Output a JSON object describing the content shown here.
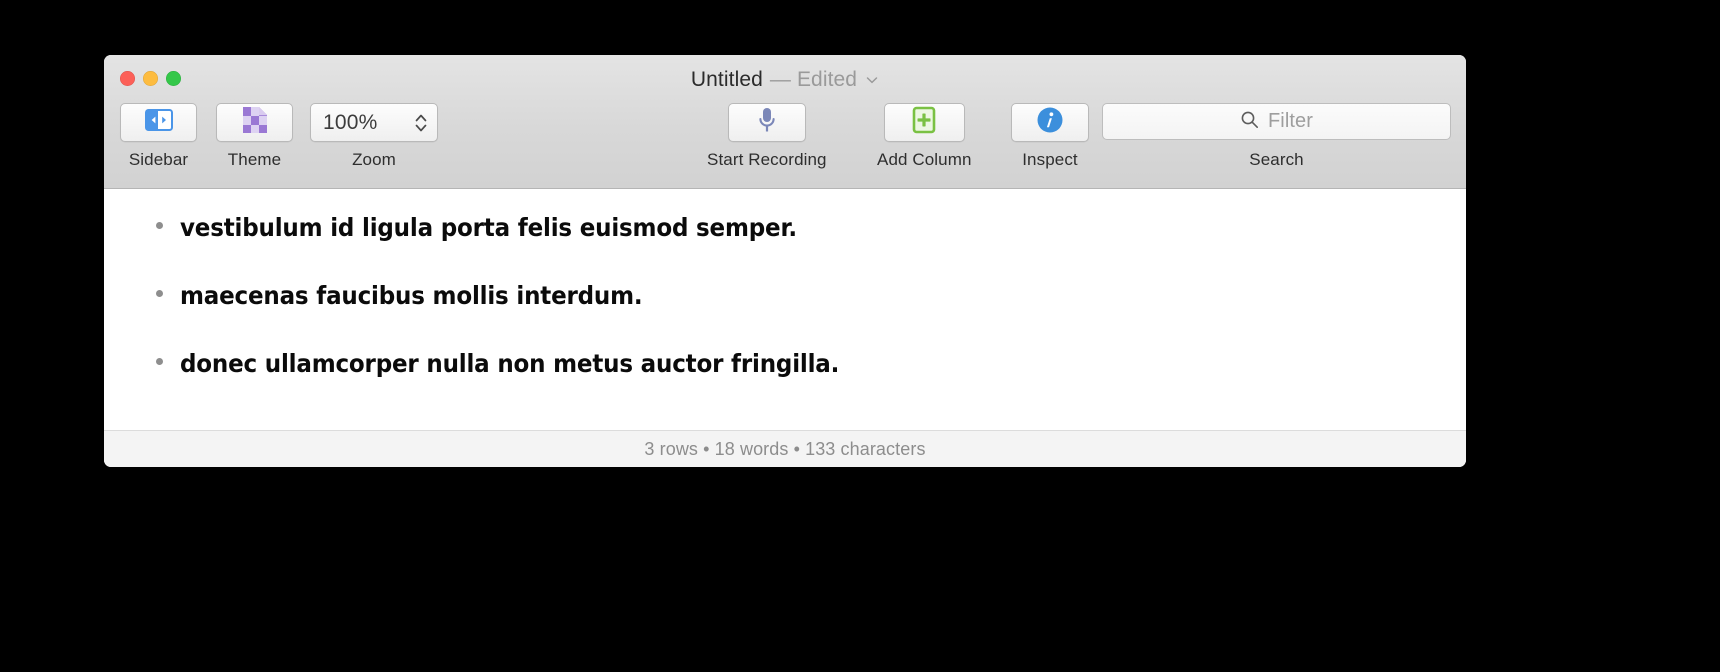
{
  "window": {
    "title": "Untitled",
    "edited_label": "— Edited",
    "title_menu_icon": "chevron-down-icon",
    "traffic_lights": [
      {
        "name": "close",
        "color": "#fc6058"
      },
      {
        "name": "minimize",
        "color": "#fdbc40"
      },
      {
        "name": "zoom",
        "color": "#34c749"
      }
    ]
  },
  "toolbar": {
    "sidebar": {
      "label": "Sidebar",
      "icon": "sidebar-icon",
      "accent": "#4a95e8"
    },
    "theme": {
      "label": "Theme",
      "icon": "theme-document-icon",
      "accent": "#9b7fd4"
    },
    "zoom": {
      "label": "Zoom",
      "value": "100%",
      "icon": "stepper-arrows-icon"
    },
    "record": {
      "label": "Start Recording",
      "icon": "microphone-icon",
      "accent": "#7b87b8"
    },
    "add_column": {
      "label": "Add Column",
      "icon": "add-column-icon",
      "accent": "#7ac143"
    },
    "inspect": {
      "label": "Inspect",
      "icon": "info-circle-icon",
      "accent": "#3c8fdc"
    },
    "search": {
      "label": "Search",
      "placeholder": "Filter",
      "value": "",
      "icon": "search-icon"
    }
  },
  "document": {
    "rows": [
      {
        "bullet": "•",
        "text": "vestibulum id ligula porta felis euismod semper."
      },
      {
        "bullet": "•",
        "text": "maecenas faucibus mollis interdum."
      },
      {
        "bullet": "•",
        "text": "donec ullamcorper nulla non metus auctor fringilla."
      }
    ]
  },
  "status": {
    "text": "3 rows • 18 words • 133 characters",
    "rows": "3 rows",
    "words": "18 words",
    "characters": "133 characters"
  }
}
